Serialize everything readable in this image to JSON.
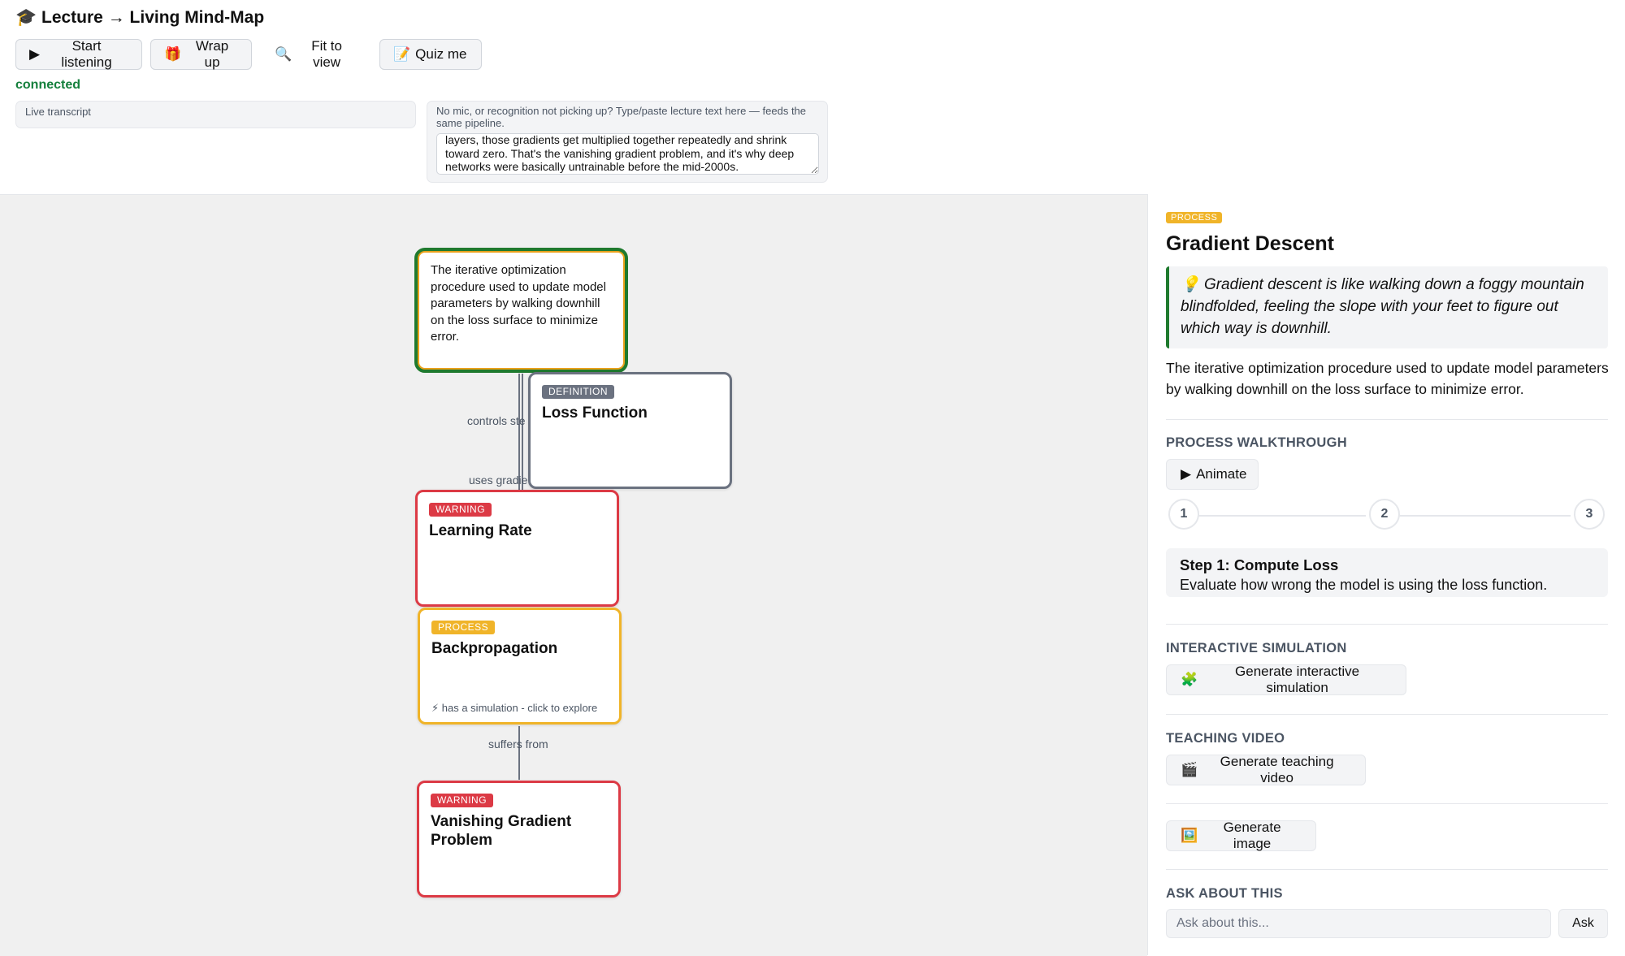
{
  "app": {
    "icon": "🎓",
    "title": "Lecture → Living Mind-Map"
  },
  "toolbar": {
    "start": {
      "icon": "▶",
      "label": "Start listening"
    },
    "wrap": {
      "icon": "🎁",
      "label": "Wrap up"
    },
    "fit": {
      "icon": "🔍",
      "label": "Fit to view"
    },
    "quiz": {
      "icon": "📝",
      "label": "Quiz me"
    }
  },
  "status": {
    "text": "connected",
    "color": "#15803d"
  },
  "transcript": {
    "label": "Live transcript"
  },
  "manual_input": {
    "hint": "No mic, or recognition not picking up? Type/paste lecture text here — feeds the same pipeline.",
    "value": "layers, those gradients get multiplied together repeatedly and shrink toward zero. That's the vanishing gradient problem, and it's why deep networks were basically untrainable before the mid-2000s."
  },
  "map": {
    "nodes": [
      {
        "id": "gradient-descent",
        "desc": "The iterative optimization procedure used to update model parameters by walking downhill on the loss surface to minimize error."
      },
      {
        "id": "loss-function",
        "tag": "DEFINITION",
        "title": "Loss Function"
      },
      {
        "id": "learning-rate",
        "tag": "WARNING",
        "title": "Learning Rate"
      },
      {
        "id": "backpropagation",
        "tag": "PROCESS",
        "title": "Backpropagation",
        "hint_icon": "⚡",
        "hint": "has a simulation - click to explore"
      },
      {
        "id": "vanishing-gradient",
        "tag": "WARNING",
        "title": "Vanishing Gradient Problem"
      }
    ],
    "edge_labels": [
      "controls ste",
      "uses gradie",
      "suffers from"
    ]
  },
  "detail": {
    "tag": "PROCESS",
    "title": "Gradient Descent",
    "analogy_icon": "💡",
    "analogy": "Gradient descent is like walking down a foggy mountain blindfolded, feeling the slope with your feet to figure out which way is downhill.",
    "summary": "The iterative optimization procedure used to update model parameters by walking downhill on the loss surface to minimize error.",
    "walkthrough": {
      "heading": "PROCESS WALKTHROUGH",
      "animate": {
        "icon": "▶",
        "label": "Animate"
      },
      "steps": [
        "1",
        "2",
        "3"
      ],
      "current": {
        "title": "Step 1: Compute Loss",
        "desc": "Evaluate how wrong the model is using the loss function."
      }
    },
    "simulation": {
      "heading": "INTERACTIVE SIMULATION",
      "icon": "🧩",
      "label": "Generate interactive simulation"
    },
    "video": {
      "heading": "TEACHING VIDEO",
      "icon": "🎬",
      "label": "Generate teaching video"
    },
    "image": {
      "icon": "🖼️",
      "label": "Generate image"
    },
    "ask": {
      "heading": "ASK ABOUT THIS",
      "placeholder": "Ask about this...",
      "button": "Ask"
    }
  },
  "colors": {
    "warning": "#dc3a45",
    "process": "#f0b429",
    "definition": "#6b7280",
    "selected_outline": "#1f7a2e"
  }
}
